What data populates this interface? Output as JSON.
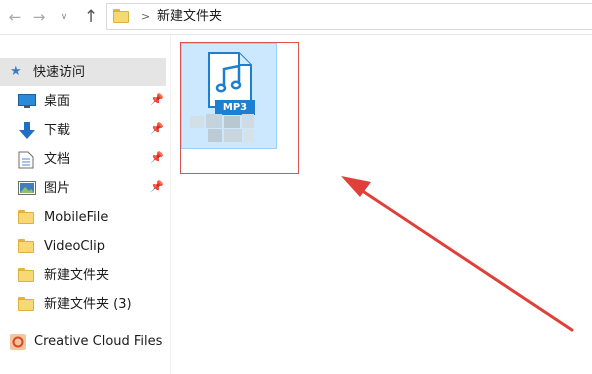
{
  "address_bar": {
    "path": "新建文件夹",
    "separator": ">",
    "back_icon": "back-arrow-icon",
    "forward_icon": "forward-arrow-icon",
    "up_icon": "up-arrow-icon"
  },
  "sidebar": {
    "quick_access": {
      "label": "快速访问",
      "icon": "star-icon"
    },
    "items": [
      {
        "label": "桌面",
        "icon": "desktop-icon",
        "pinned": true
      },
      {
        "label": "下载",
        "icon": "download-icon",
        "pinned": true
      },
      {
        "label": "文档",
        "icon": "document-icon",
        "pinned": true
      },
      {
        "label": "图片",
        "icon": "pictures-icon",
        "pinned": true
      },
      {
        "label": "MobileFile",
        "icon": "folder-icon",
        "pinned": false
      },
      {
        "label": "VideoClip",
        "icon": "folder-icon",
        "pinned": false
      },
      {
        "label": "新建文件夹",
        "icon": "folder-icon",
        "pinned": false
      },
      {
        "label": "新建文件夹 (3)",
        "icon": "folder-icon",
        "pinned": false
      }
    ],
    "creative_cloud": {
      "label": "Creative Cloud Files",
      "icon": "creative-cloud-icon"
    }
  },
  "main": {
    "file": {
      "badge": "MP3",
      "icon": "mp3-file-icon",
      "name_hidden": true
    },
    "colors": {
      "highlight": "#d9534f",
      "arrow": "#e0403a",
      "selection": "#cce8ff",
      "badge": "#1e7fce"
    }
  }
}
